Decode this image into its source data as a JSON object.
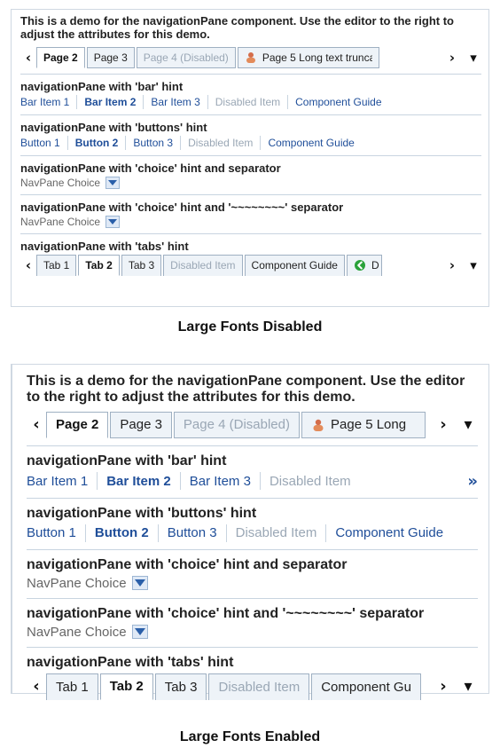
{
  "demo_small": {
    "intro": "This is a demo for the navigationPane component. Use the editor to the right to adjust the attributes for this demo.",
    "top_tabs": [
      {
        "label": "Page 2",
        "state": "selected"
      },
      {
        "label": "Page 3",
        "state": "normal"
      },
      {
        "label": "Page 4 (Disabled)",
        "state": "disabled"
      },
      {
        "label": "Page 5 Long text truncat",
        "state": "normal",
        "icon": "person-icon"
      }
    ],
    "sections": [
      {
        "hint": "navigationPane with 'bar' hint",
        "items": [
          {
            "label": "Bar Item 1",
            "state": "normal"
          },
          {
            "label": "Bar Item 2",
            "state": "selected"
          },
          {
            "label": "Bar Item 3",
            "state": "normal"
          },
          {
            "label": "Disabled Item",
            "state": "disabled"
          },
          {
            "label": "Component Guide",
            "state": "normal"
          }
        ]
      },
      {
        "hint": "navigationPane with 'buttons' hint",
        "items": [
          {
            "label": "Button 1",
            "state": "normal"
          },
          {
            "label": "Button 2",
            "state": "selected"
          },
          {
            "label": "Button 3",
            "state": "normal"
          },
          {
            "label": "Disabled Item",
            "state": "disabled"
          },
          {
            "label": "Component Guide",
            "state": "normal"
          }
        ]
      },
      {
        "hint": "navigationPane with 'choice' hint and separator",
        "choice": "NavPane Choice"
      },
      {
        "hint": "navigationPane with 'choice' hint and '~~~~~~~~' separator",
        "choice": "NavPane Choice"
      },
      {
        "hint": "navigationPane with 'tabs' hint",
        "tabs": [
          {
            "label": "Tab 1",
            "state": "normal"
          },
          {
            "label": "Tab 2",
            "state": "selected"
          },
          {
            "label": "Tab 3",
            "state": "normal"
          },
          {
            "label": "Disabled Item",
            "state": "disabled"
          },
          {
            "label": "Component Guide",
            "state": "normal"
          },
          {
            "label": "D",
            "state": "normal",
            "icon": "green-arrow-icon"
          }
        ]
      }
    ],
    "caption": "Large Fonts Disabled"
  },
  "demo_large": {
    "intro": "This is a demo for the navigationPane component. Use the editor to the right to adjust the attributes for this demo.",
    "top_tabs": [
      {
        "label": "Page 2",
        "state": "selected"
      },
      {
        "label": "Page 3",
        "state": "normal"
      },
      {
        "label": "Page 4 (Disabled)",
        "state": "disabled"
      },
      {
        "label": "Page 5 Long",
        "state": "normal",
        "icon": "person-icon"
      }
    ],
    "sections": [
      {
        "hint": "navigationPane with 'bar' hint",
        "items": [
          {
            "label": "Bar Item 1",
            "state": "normal"
          },
          {
            "label": "Bar Item 2",
            "state": "selected"
          },
          {
            "label": "Bar Item 3",
            "state": "normal"
          },
          {
            "label": "Disabled Item",
            "state": "disabled"
          }
        ],
        "overflow": "»"
      },
      {
        "hint": "navigationPane with 'buttons' hint",
        "items": [
          {
            "label": "Button 1",
            "state": "normal"
          },
          {
            "label": "Button 2",
            "state": "selected"
          },
          {
            "label": "Button 3",
            "state": "normal"
          },
          {
            "label": "Disabled Item",
            "state": "disabled"
          },
          {
            "label": "Component Guide",
            "state": "normal"
          }
        ]
      },
      {
        "hint": "navigationPane with 'choice' hint and separator",
        "choice": "NavPane Choice"
      },
      {
        "hint": "navigationPane with 'choice' hint and '~~~~~~~~' separator",
        "choice": "NavPane Choice"
      },
      {
        "hint": "navigationPane with 'tabs' hint",
        "tabs": [
          {
            "label": "Tab 1",
            "state": "normal"
          },
          {
            "label": "Tab 2",
            "state": "selected"
          },
          {
            "label": "Tab 3",
            "state": "normal"
          },
          {
            "label": "Disabled Item",
            "state": "disabled"
          },
          {
            "label": "Component Gu",
            "state": "normal"
          }
        ]
      }
    ],
    "caption": "Large Fonts Enabled"
  },
  "icons": {
    "left": "‹",
    "right": "›",
    "menu": "▾"
  }
}
